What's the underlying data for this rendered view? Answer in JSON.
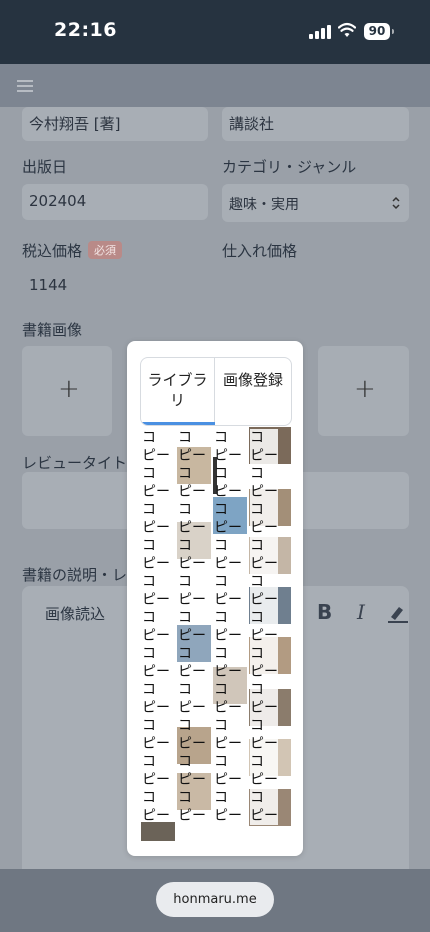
{
  "status_bar": {
    "time": "22:16",
    "battery": "90"
  },
  "form": {
    "author_value": "今村翔吾 [著]",
    "publisher_value": "講談社",
    "publish_date_label": "出版日",
    "publish_date_value": "202404",
    "category_label": "カテゴリ・ジャンル",
    "category_value": "趣味・実用",
    "price_label": "税込価格",
    "required_badge": "必須",
    "price_value": "1144",
    "cost_label": "仕入れ価格",
    "book_image_label": "書籍画像",
    "plus": "+",
    "review_title_label": "レビュータイトル",
    "description_label": "書籍の説明・レビュ",
    "image_read_label": "画像読込",
    "bold": "B",
    "italic": "I"
  },
  "modal": {
    "tabs": [
      {
        "label": "ライブラリ"
      },
      {
        "label": "画像登録"
      }
    ],
    "thumb_text": "コ\nピー\nコ\nピー\nコ\nピー\nコ\nピー\nコ\nピー\nコ\nピー\nコ\nピー\nコ\nピー\nコ\nピー\nコ\nピー\nコ\nピー"
  },
  "browser": {
    "url": "honmaru.me"
  }
}
